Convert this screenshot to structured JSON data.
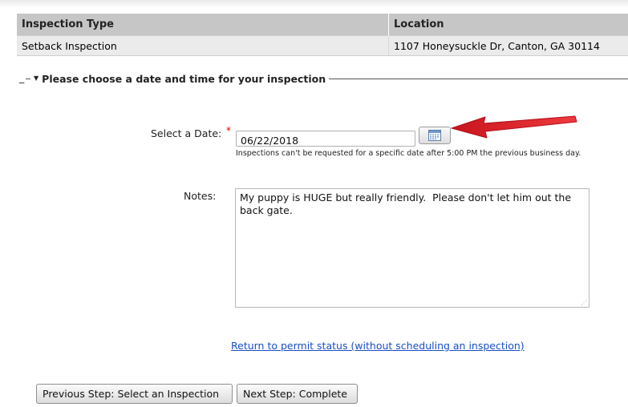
{
  "table": {
    "headers": [
      "Inspection Type",
      "Location"
    ],
    "rows": [
      [
        "Setback Inspection",
        "1107 Honeysuckle Dr, Canton, GA 30114"
      ]
    ]
  },
  "section": {
    "collapse_marker": "_",
    "title": "Please choose a date and time for your inspection"
  },
  "form": {
    "date_label": "Select a Date:",
    "required_marker": "*",
    "date_value": "06/22/2018",
    "date_hint": "Inspections can't be requested for a specific date after 5:00 PM the previous business day.",
    "notes_label": "Notes:",
    "notes_value": "My puppy is HUGE but really friendly.  Please don't let him out the back gate."
  },
  "links": {
    "return": "Return to permit status (without scheduling an inspection)"
  },
  "buttons": {
    "previous": "Previous Step: Select an Inspection",
    "next": "Next Step: Complete"
  },
  "colors": {
    "annotation_arrow": "#e8262c",
    "link": "#1a4fc7",
    "required": "#d00000"
  },
  "icons": {
    "calendar": "calendar-icon",
    "legend_toggle": "triangle-down-icon"
  }
}
